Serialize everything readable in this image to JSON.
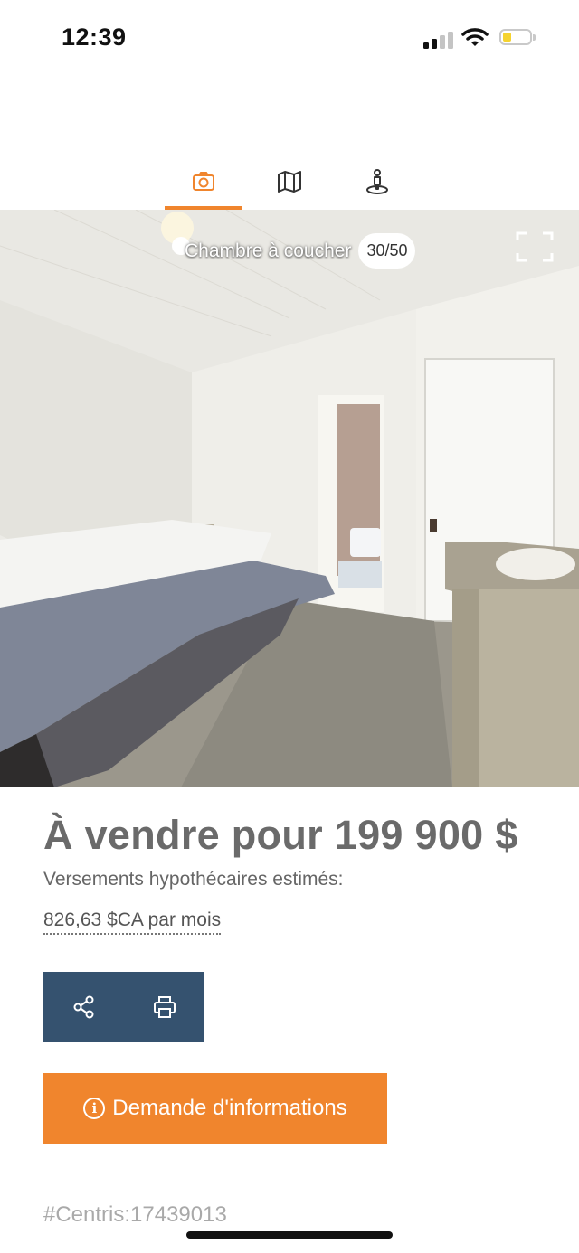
{
  "status_bar": {
    "time": "12:39",
    "battery_color": "#f5d32f"
  },
  "tabs": [
    {
      "name": "photos",
      "icon": "camera-icon",
      "active": true
    },
    {
      "name": "map",
      "icon": "map-icon",
      "active": false
    },
    {
      "name": "street-view",
      "icon": "street-view-icon",
      "active": false
    }
  ],
  "gallery": {
    "caption": "Chambre à coucher",
    "counter": "30/50"
  },
  "listing": {
    "price": "À vendre pour 199 900 $",
    "mortgage_label": "Versements hypothécaires estimés:",
    "mortgage_value": "826,63 $CA par mois",
    "info_button_label": "Demande d'informations",
    "centris_id": "#Centris:17439013"
  },
  "colors": {
    "accent": "#f0852d",
    "action_bar": "#35526f"
  }
}
